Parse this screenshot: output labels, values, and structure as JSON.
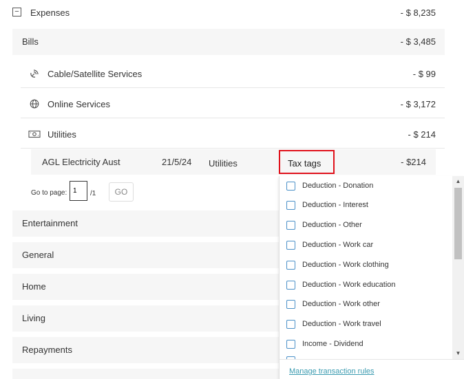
{
  "expenses": {
    "label": "Expenses",
    "amount": "- $ 8,235",
    "collapse_symbol": "−"
  },
  "bills": {
    "label": "Bills",
    "amount": "- $ 3,485"
  },
  "subcategories": [
    {
      "label": "Cable/Satellite Services",
      "amount": "- $ 99",
      "icon": "satellite-icon"
    },
    {
      "label": "Online Services",
      "amount": "- $ 3,172",
      "icon": "globe-icon"
    },
    {
      "label": "Utilities",
      "amount": "- $ 214",
      "icon": "money-icon"
    }
  ],
  "transaction": {
    "merchant": "AGL Electricity Aust",
    "date": "21/5/24",
    "category": "Utilities",
    "tax_tags_label": "Tax tags",
    "amount": "- $214"
  },
  "pagination": {
    "label": "Go to page:",
    "value": "1",
    "total": "/1",
    "go_label": "GO"
  },
  "categories": [
    {
      "label": "Entertainment"
    },
    {
      "label": "General"
    },
    {
      "label": "Home"
    },
    {
      "label": "Living"
    },
    {
      "label": "Repayments"
    }
  ],
  "tax_tag_options": [
    "Deduction - Donation",
    "Deduction - Interest",
    "Deduction - Other",
    "Deduction - Work car",
    "Deduction - Work clothing",
    "Deduction - Work education",
    "Deduction - Work other",
    "Deduction - Work travel",
    "Income - Dividend"
  ],
  "manage_rules_link": "Manage transaction rules",
  "colors": {
    "negative": "#d25050",
    "highlight_border": "#e0101a",
    "link": "#3a9bb0",
    "checkbox": "#4a90c8"
  }
}
